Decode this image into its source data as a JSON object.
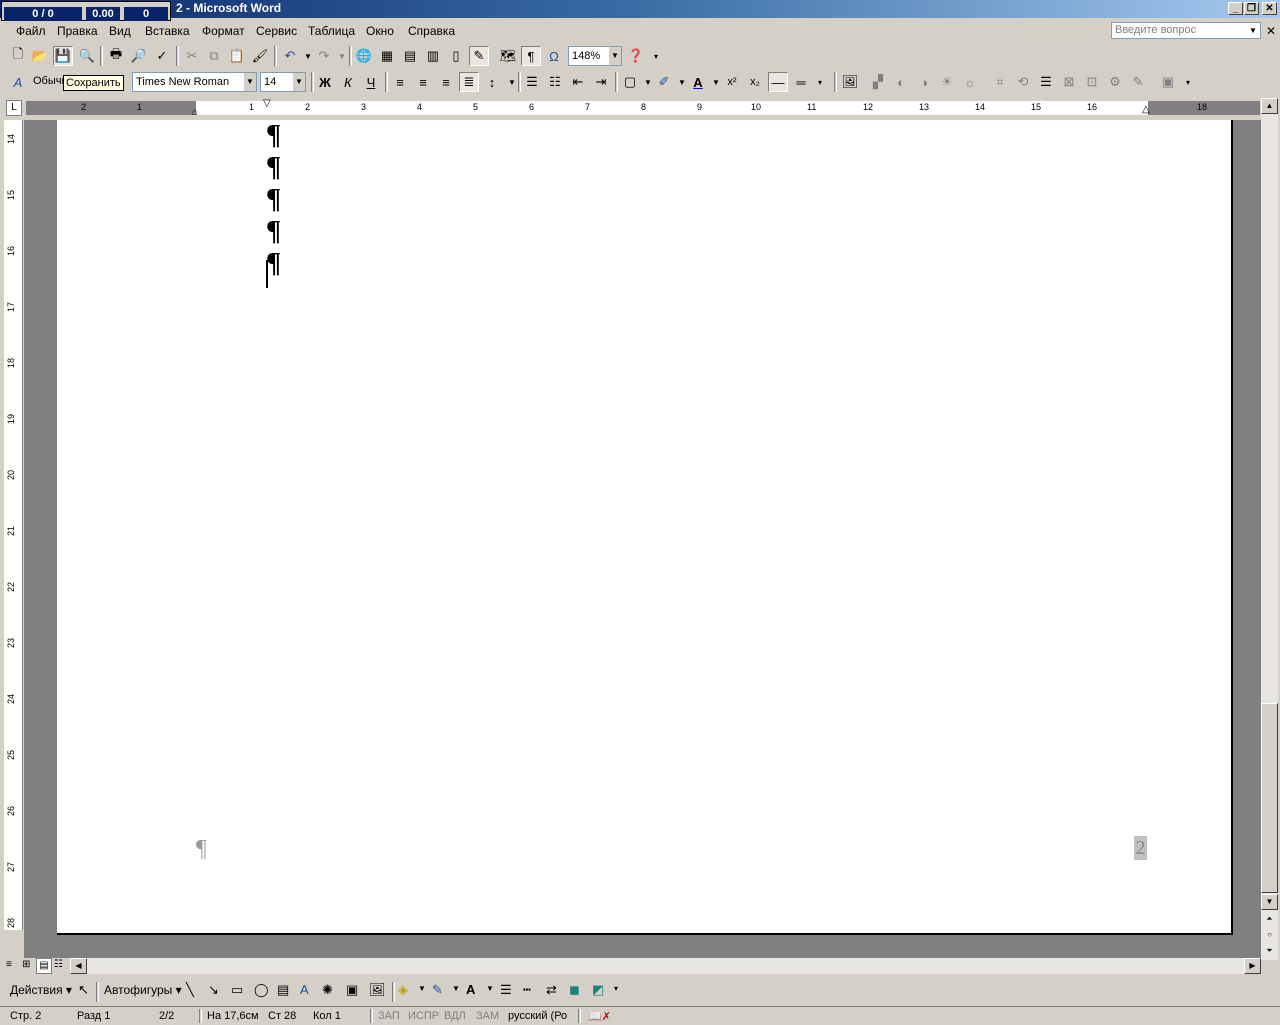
{
  "window": {
    "title": "2 - Microsoft Word",
    "counter": {
      "a": "0 / 0",
      "b": "0.00",
      "c": "0"
    }
  },
  "menu": [
    "Файл",
    "Правка",
    "Вид",
    "Вставка",
    "Формат",
    "Сервис",
    "Таблица",
    "Окно",
    "Справка"
  ],
  "help_placeholder": "Введите вопрос",
  "toolbar": {
    "zoom": "148%",
    "style": "Обычн",
    "font": "Times New Roman",
    "size": "14",
    "bold": "Ж",
    "italic": "К",
    "underline": "Ч",
    "tooltip": "Сохранить"
  },
  "ruler": {
    "h_labels": [
      "2",
      "1",
      "1",
      "2",
      "3",
      "4",
      "5",
      "6",
      "7",
      "8",
      "9",
      "10",
      "11",
      "12",
      "13",
      "14",
      "15",
      "16",
      "18"
    ],
    "v_labels": [
      "14",
      "15",
      "16",
      "17",
      "18",
      "19",
      "20",
      "21",
      "22",
      "23",
      "24",
      "25",
      "26",
      "27",
      "28"
    ]
  },
  "document": {
    "pilcrow": "¶",
    "page_number": "2"
  },
  "drawbar": {
    "actions": "Действия",
    "autoshapes": "Автофигуры"
  },
  "status": {
    "page": "Стр. 2",
    "section": "Разд 1",
    "pages": "2/2",
    "at": "На 17,6см",
    "line": "Ст 28",
    "col": "Кол 1",
    "rec": "ЗАП",
    "trk": "ИСПР",
    "ext": "ВДЛ",
    "ovr": "ЗАМ",
    "lang": "русский (Ро"
  }
}
